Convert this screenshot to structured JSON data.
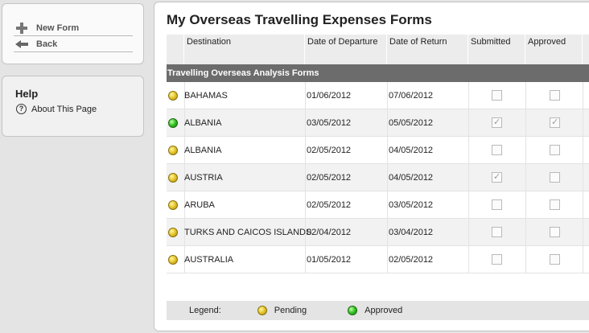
{
  "nav": {
    "new_form": "New Form",
    "back": "Back"
  },
  "help": {
    "title": "Help",
    "about": "About This Page"
  },
  "page": {
    "title": "My Overseas Travelling Expenses Forms"
  },
  "table": {
    "columns": {
      "destination": "Destination",
      "departure": "Date of Departure",
      "return": "Date of Return",
      "submitted": "Submitted",
      "approved": "Approved"
    },
    "group_label": "Travelling Overseas Analysis Forms",
    "rows": [
      {
        "status": "pending",
        "destination": "BAHAMAS",
        "departure": "01/06/2012",
        "return": "07/06/2012",
        "submitted": false,
        "approved": false
      },
      {
        "status": "approved",
        "destination": "ALBANIA",
        "departure": "03/05/2012",
        "return": "05/05/2012",
        "submitted": true,
        "approved": true
      },
      {
        "status": "pending",
        "destination": "ALBANIA",
        "departure": "02/05/2012",
        "return": "04/05/2012",
        "submitted": false,
        "approved": false
      },
      {
        "status": "pending",
        "destination": "AUSTRIA",
        "departure": "02/05/2012",
        "return": "04/05/2012",
        "submitted": true,
        "approved": false
      },
      {
        "status": "pending",
        "destination": "ARUBA",
        "departure": "02/05/2012",
        "return": "03/05/2012",
        "submitted": false,
        "approved": false
      },
      {
        "status": "pending",
        "destination": "TURKS AND CAICOS ISLANDS",
        "departure": "02/04/2012",
        "return": "03/04/2012",
        "submitted": false,
        "approved": false
      },
      {
        "status": "pending",
        "destination": "AUSTRALIA",
        "departure": "01/05/2012",
        "return": "02/05/2012",
        "submitted": false,
        "approved": false
      }
    ]
  },
  "legend": {
    "label": "Legend:",
    "pending": "Pending",
    "approved": "Approved"
  },
  "colors": {
    "group_header_bg": "#6c6c6c",
    "pending": "#e8c830",
    "approved": "#38c828"
  }
}
